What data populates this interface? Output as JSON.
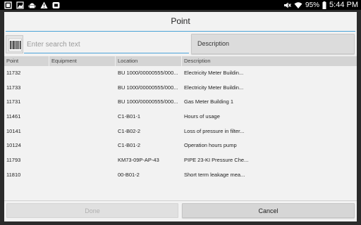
{
  "status_bar": {
    "battery": "95%",
    "time": "5:44 PM",
    "left_icons": [
      "notification-icon",
      "gallery-icon",
      "android-icon",
      "alert-icon",
      "app-icon"
    ],
    "right_icons": [
      "mute-icon",
      "wifi-icon",
      "battery-icon"
    ]
  },
  "dialog": {
    "title": "Point",
    "search": {
      "placeholder": "Enter search text",
      "value": ""
    },
    "search_field_button": "Description",
    "columns": [
      "Point",
      "Equipment",
      "Location",
      "Description"
    ],
    "rows": [
      {
        "point": "11732",
        "equipment": "",
        "location": "BU 1000/00000555/000...",
        "description": "Electricity Meter Buildin..."
      },
      {
        "point": "11733",
        "equipment": "",
        "location": "BU 1000/00000555/000...",
        "description": "Electricity Meter Buildin..."
      },
      {
        "point": "11731",
        "equipment": "",
        "location": "BU 1000/00000555/000...",
        "description": "Gas Meter Building 1"
      },
      {
        "point": "11461",
        "equipment": "",
        "location": "C1-B01-1",
        "description": "Hours of usage"
      },
      {
        "point": "10141",
        "equipment": "",
        "location": "C1-B02-2",
        "description": "Loss of pressure in filter..."
      },
      {
        "point": "10124",
        "equipment": "",
        "location": "C1-B01-2",
        "description": "Operation hours pump"
      },
      {
        "point": "11793",
        "equipment": "",
        "location": "KM73-09P-AP-43",
        "description": "PIPE 23-KI Pressure Che..."
      },
      {
        "point": "11810",
        "equipment": "",
        "location": "00-B01-2",
        "description": "Short term leakage mea..."
      }
    ],
    "done_label": "Done",
    "cancel_label": "Cancel"
  },
  "colors": {
    "accent": "#4aa3d8",
    "dialog_bg": "#f2f2f2",
    "header_bg": "#d4d4d4"
  }
}
